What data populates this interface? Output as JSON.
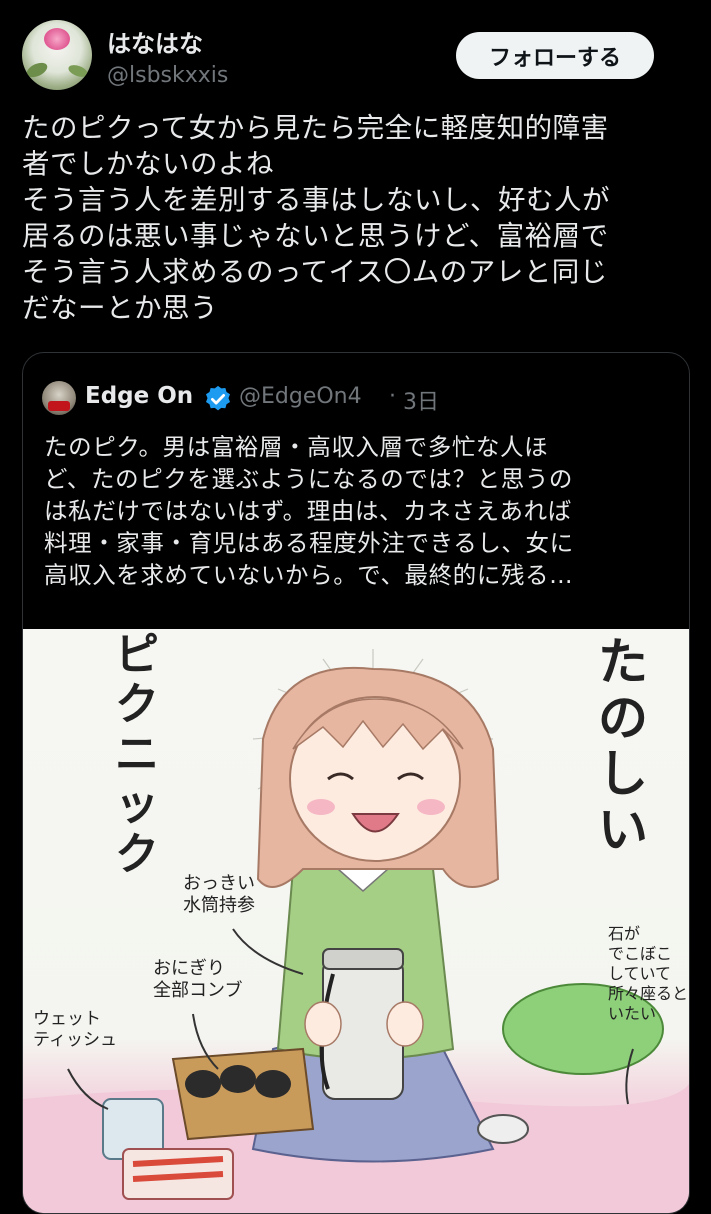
{
  "author": {
    "display_name": "はなはな",
    "handle": "@lsbskxxis",
    "avatar_icon": "flower-avatar"
  },
  "follow_button": {
    "label": "フォローする"
  },
  "tweet": {
    "text": "たのピクって女から見たら完全に軽度知的障害\n者でしかないのよね\nそう言う人を差別する事はしないし、好む人が\n居るのは悪い事じゃないと思うけど、富裕層で\nそう言う人求めるのってイス〇ムのアレと同じ\nだなーとか思う"
  },
  "quoted_tweet": {
    "display_name": "Edge On",
    "verified_icon": "verified-badge-icon",
    "handle": "@EdgeOn4",
    "separator": "·",
    "time": "3日",
    "text": "たのピク。男は富裕層・高収入層で多忙な人ほ\nど、たのピクを選ぶようになるのでは？と思うの\nは私だけではないはず。理由は、カネさえあれば\n料理・家事・育児はある程度外注できるし、女に\n高収入を求めていないから。で、最終的に残る…",
    "image": {
      "title_vertical": "ピクニック",
      "caption_vertical": "たのしい",
      "notes": {
        "bottle": "おっきい\n水筒持参",
        "onigiri": "おにぎり\n全部コンブ",
        "tissue": "ウェット\nティッシュ",
        "stones": "石が\nでこぼこ\nしていて\n所々座ると\nいたい"
      }
    }
  },
  "colors": {
    "background": "#000000",
    "text": "#e7e9ea",
    "secondary": "#71767b",
    "border": "#2f3336",
    "verified": "#1d9bf0",
    "button_bg": "#eff3f4"
  }
}
